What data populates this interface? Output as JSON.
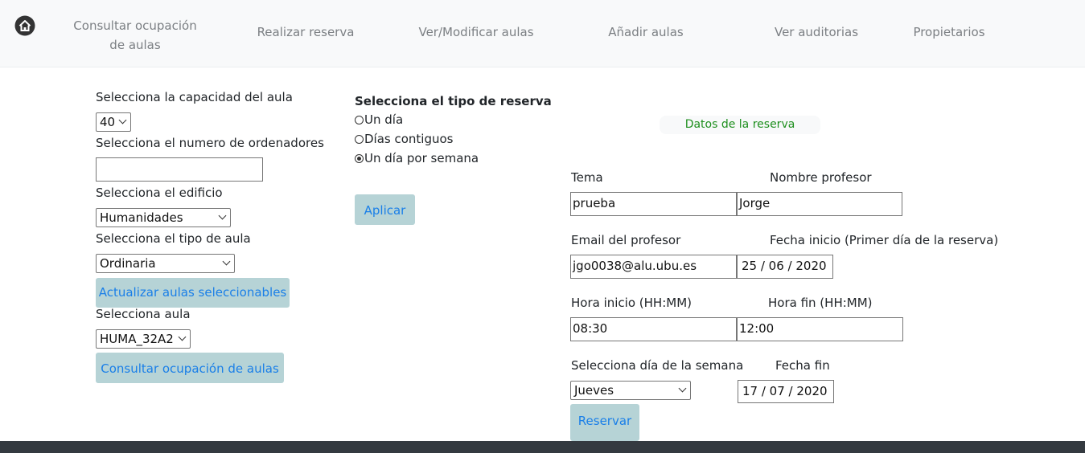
{
  "nav": {
    "items": [
      {
        "label": "Consultar ocupación de aulas"
      },
      {
        "label": "Realizar reserva"
      },
      {
        "label": "Ver/Modificar aulas"
      },
      {
        "label": "Añadir aulas"
      },
      {
        "label": "Ver auditorias"
      },
      {
        "label": "Propietarios"
      }
    ]
  },
  "left": {
    "capacidad_label": "Selecciona la capacidad del aula",
    "capacidad_value": "40",
    "ordenadores_label": "Selecciona el numero de ordenadores",
    "ordenadores_value": "",
    "edificio_label": "Selecciona el edificio",
    "edificio_value": "Humanidades",
    "tipo_aula_label": "Selecciona el tipo de aula",
    "tipo_aula_value": "Ordinaria",
    "actualizar_button": "Actualizar aulas seleccionables",
    "aula_label": "Selecciona aula",
    "aula_value": "HUMA_32A2",
    "consultar_button": "Consultar ocupación de aulas"
  },
  "middle": {
    "tipo_reserva_label": "Selecciona el tipo de reserva",
    "options": [
      {
        "label": "Un día",
        "checked": false
      },
      {
        "label": "Días contiguos",
        "checked": false
      },
      {
        "label": "Un día por semana",
        "checked": true
      }
    ],
    "aplicar_button": "Aplicar"
  },
  "reserva": {
    "title": "Datos de la reserva",
    "tema_label": "Tema",
    "tema_value": "prueba",
    "profesor_label": "Nombre profesor",
    "profesor_value": "Jorge",
    "email_label": "Email del profesor",
    "email_value": "jgo0038@alu.ubu.es",
    "fecha_inicio_label": "Fecha inicio (Primer día de la reserva)",
    "fecha_inicio_value": "25 / 06 / 2020",
    "hora_inicio_label": "Hora inicio (HH:MM)",
    "hora_inicio_value": "08:30",
    "hora_fin_label": "Hora fin (HH:MM)",
    "hora_fin_value": "12:00",
    "dia_semana_label": "Selecciona día de la semana",
    "dia_semana_value": "Jueves",
    "fecha_fin_label": "Fecha fin",
    "fecha_fin_value": "17 / 07 / 2020",
    "reservar_button": "Reservar"
  },
  "icons": {
    "home": "home-icon",
    "chevron": "chevron-down-icon"
  },
  "colors": {
    "button_bg": "#b6d3d6",
    "button_text": "#1a7fe8",
    "title_green": "#1e8f1e",
    "navbar_bg": "#f8f9fa",
    "footer_bg": "#343a40"
  }
}
